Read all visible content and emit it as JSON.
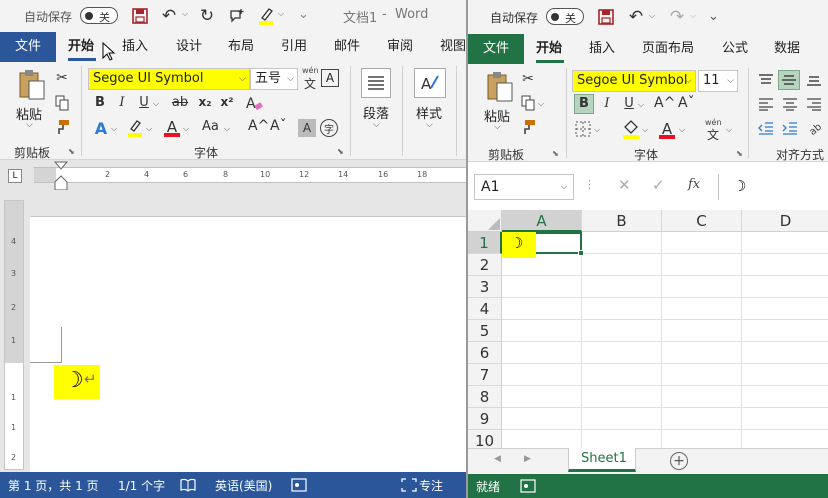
{
  "word": {
    "title_bar": {
      "autosave_label": "自动保存",
      "autosave_state": "关",
      "doc_title": "文档1",
      "sep": "-",
      "app_name": "Word"
    },
    "tabs": [
      "文件",
      "开始",
      "插入",
      "设计",
      "布局",
      "引用",
      "邮件",
      "审阅",
      "视图"
    ],
    "ribbon": {
      "paste_label": "粘贴",
      "clipboard_group": "剪贴板",
      "font_name": "Segoe UI Symbol",
      "font_size": "五号",
      "wen_label": "wén",
      "font_group": "字体",
      "paragraph_label": "段落",
      "styles_label": "样式",
      "bold": "B",
      "italic": "I",
      "underline": "U",
      "strike": "ab",
      "sub": "x₂",
      "sup": "x²",
      "case": "Aa",
      "grow": "A^",
      "shrink": "Aˇ",
      "char_shade": "A",
      "char_border": "A",
      "enclose": "字"
    },
    "ruler_numbers": [
      "2",
      "4",
      "6",
      "8",
      "10",
      "12",
      "14",
      "16",
      "18"
    ],
    "vruler_numbers": [
      "4",
      "3",
      "2",
      "1",
      "1",
      "1",
      "2"
    ],
    "doc": {
      "symbol": "☽",
      "pilcrow": "↵"
    },
    "status": {
      "page": "第 1 页，共 1 页",
      "words": "1/1 个字",
      "lang": "英语(美国)",
      "focus": "专注"
    }
  },
  "excel": {
    "title_bar": {
      "autosave_label": "自动保存",
      "autosave_state": "关"
    },
    "tabs": [
      "文件",
      "开始",
      "插入",
      "页面布局",
      "公式",
      "数据"
    ],
    "ribbon": {
      "paste_label": "粘贴",
      "clipboard_group": "剪贴板",
      "font_name": "Segoe UI Symbol",
      "font_size": "11",
      "font_group": "字体",
      "align_group": "对齐方式",
      "bold": "B",
      "italic": "I",
      "underline": "U",
      "grow": "A^",
      "shrink": "Aˇ",
      "wen_label": "wén"
    },
    "name_box": "A1",
    "fx": "fx",
    "formula_value": "☽",
    "columns": [
      "A",
      "B",
      "C",
      "D"
    ],
    "rows": [
      "1",
      "2",
      "3",
      "4",
      "5",
      "6",
      "7",
      "8",
      "9",
      "10"
    ],
    "cell_a1": "☽",
    "sheet_tab": "Sheet1",
    "status": {
      "ready": "就绪"
    }
  },
  "colors": {
    "word_blue": "#2b579a",
    "excel_green": "#217346",
    "highlight": "#ffff00",
    "font_red": "#e81123"
  }
}
